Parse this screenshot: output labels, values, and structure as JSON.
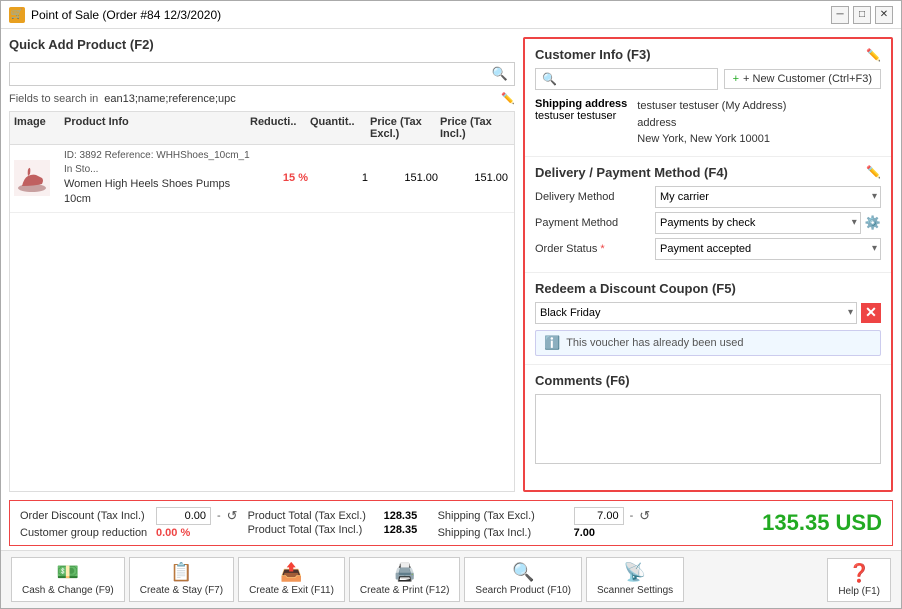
{
  "titleBar": {
    "title": "Point of Sale (Order #84 12/3/2020)"
  },
  "quickAdd": {
    "title": "Quick Add Product (F2)",
    "searchPlaceholder": "",
    "fieldsLabel": "Fields to search in",
    "fieldsValue": "ean13;name;reference;upc"
  },
  "table": {
    "headers": [
      "Image",
      "Product Info",
      "Reducti..",
      "Quantit..",
      "Price (Tax Excl.)",
      "Price (Tax Incl.)"
    ],
    "rows": [
      {
        "id": "ID: 3892  Reference: WHHShoes_10cm_1  In Sto...",
        "name": "Women High Heels Shoes Pumps 10cm",
        "discount": "15 %",
        "qty": "1",
        "priceExcl": "151.00",
        "priceIncl": "151.00"
      }
    ]
  },
  "customerInfo": {
    "title": "Customer Info (F3)",
    "newCustomerBtn": "+ New Customer (Ctrl+F3)",
    "shippingAddressLabel": "Shipping address",
    "customerName": "testuser testuser",
    "shippingName": "testuser testuser (My Address)",
    "shippingLine1": "address",
    "shippingLine2": "New York, New York 10001"
  },
  "delivery": {
    "title": "Delivery / Payment Method (F4)",
    "deliveryLabel": "Delivery Method",
    "deliveryValue": "My carrier",
    "paymentLabel": "Payment Method",
    "paymentValue": "Payments by check",
    "statusLabel": "Order Status",
    "statusRequired": true,
    "statusValue": "Payment accepted"
  },
  "coupon": {
    "title": "Redeem a Discount Coupon (F5)",
    "couponValue": "Black Friday",
    "warningText": "This voucher has already been used"
  },
  "comments": {
    "title": "Comments (F6)"
  },
  "totals": {
    "orderDiscountLabel": "Order Discount (Tax Incl.)",
    "orderDiscountValue": "0.00",
    "orderDiscountUnit": "-",
    "customerGroupLabel": "Customer group reduction",
    "customerGroupValue": "0.00 %",
    "productTotalExclLabel": "Product Total (Tax Excl.)",
    "productTotalExclValue": "128.35",
    "productTotalInclLabel": "Product Total (Tax Incl.)",
    "productTotalInclValue": "128.35",
    "shippingExclLabel": "Shipping (Tax Excl.)",
    "shippingExclValue": "7.00",
    "shippingInclLabel": "Shipping (Tax Incl.)",
    "shippingInclValue": "7.00",
    "grandTotal": "135.35 USD"
  },
  "footer": {
    "buttons": [
      {
        "label": "Cash & Change (F9)",
        "icon": "💵"
      },
      {
        "label": "Create & Stay (F7)",
        "icon": "📋"
      },
      {
        "label": "Create & Exit (F11)",
        "icon": "📤"
      },
      {
        "label": "Create & Print (F12)",
        "icon": "🖨️"
      },
      {
        "label": "Search Product (F10)",
        "icon": "🔍"
      },
      {
        "label": "Scanner Settings",
        "icon": "📡"
      }
    ],
    "helpLabel": "Help (F1)"
  }
}
